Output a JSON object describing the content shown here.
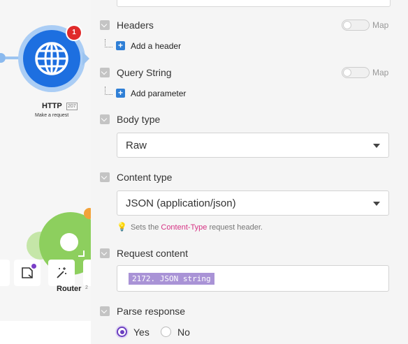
{
  "canvas": {
    "http_module": {
      "title": "HTTP",
      "id": "207",
      "subtitle": "Make a request",
      "badge": "1",
      "icon": "globe-icon"
    },
    "router_module": {
      "label": "Router",
      "id": "2",
      "icon": "router-icon"
    },
    "toolbar": {
      "note_icon": "note-icon",
      "magic_icon": "magic-wand-icon"
    },
    "colors": {
      "http": "#1d6fe0",
      "router": "#8dcf5e",
      "badge": "#e02a2a"
    }
  },
  "panel": {
    "headers": {
      "label": "Headers",
      "map_label": "Map",
      "add_label": "Add a header"
    },
    "query_string": {
      "label": "Query String",
      "map_label": "Map",
      "add_label": "Add parameter"
    },
    "body_type": {
      "label": "Body type",
      "value": "Raw"
    },
    "content_type": {
      "label": "Content type",
      "value": "JSON (application/json)",
      "hint_prefix": "Sets the",
      "hint_highlight": "Content-Type",
      "hint_suffix": "request header."
    },
    "request_content": {
      "label": "Request content",
      "token": "2172. JSON string"
    },
    "parse_response": {
      "label": "Parse response",
      "options": [
        "Yes",
        "No"
      ],
      "selected": "Yes"
    },
    "colors": {
      "accent": "#6b3fc0",
      "add_button": "#2f7fd6",
      "token": "#a993d6",
      "hint_highlight": "#d63384"
    }
  }
}
